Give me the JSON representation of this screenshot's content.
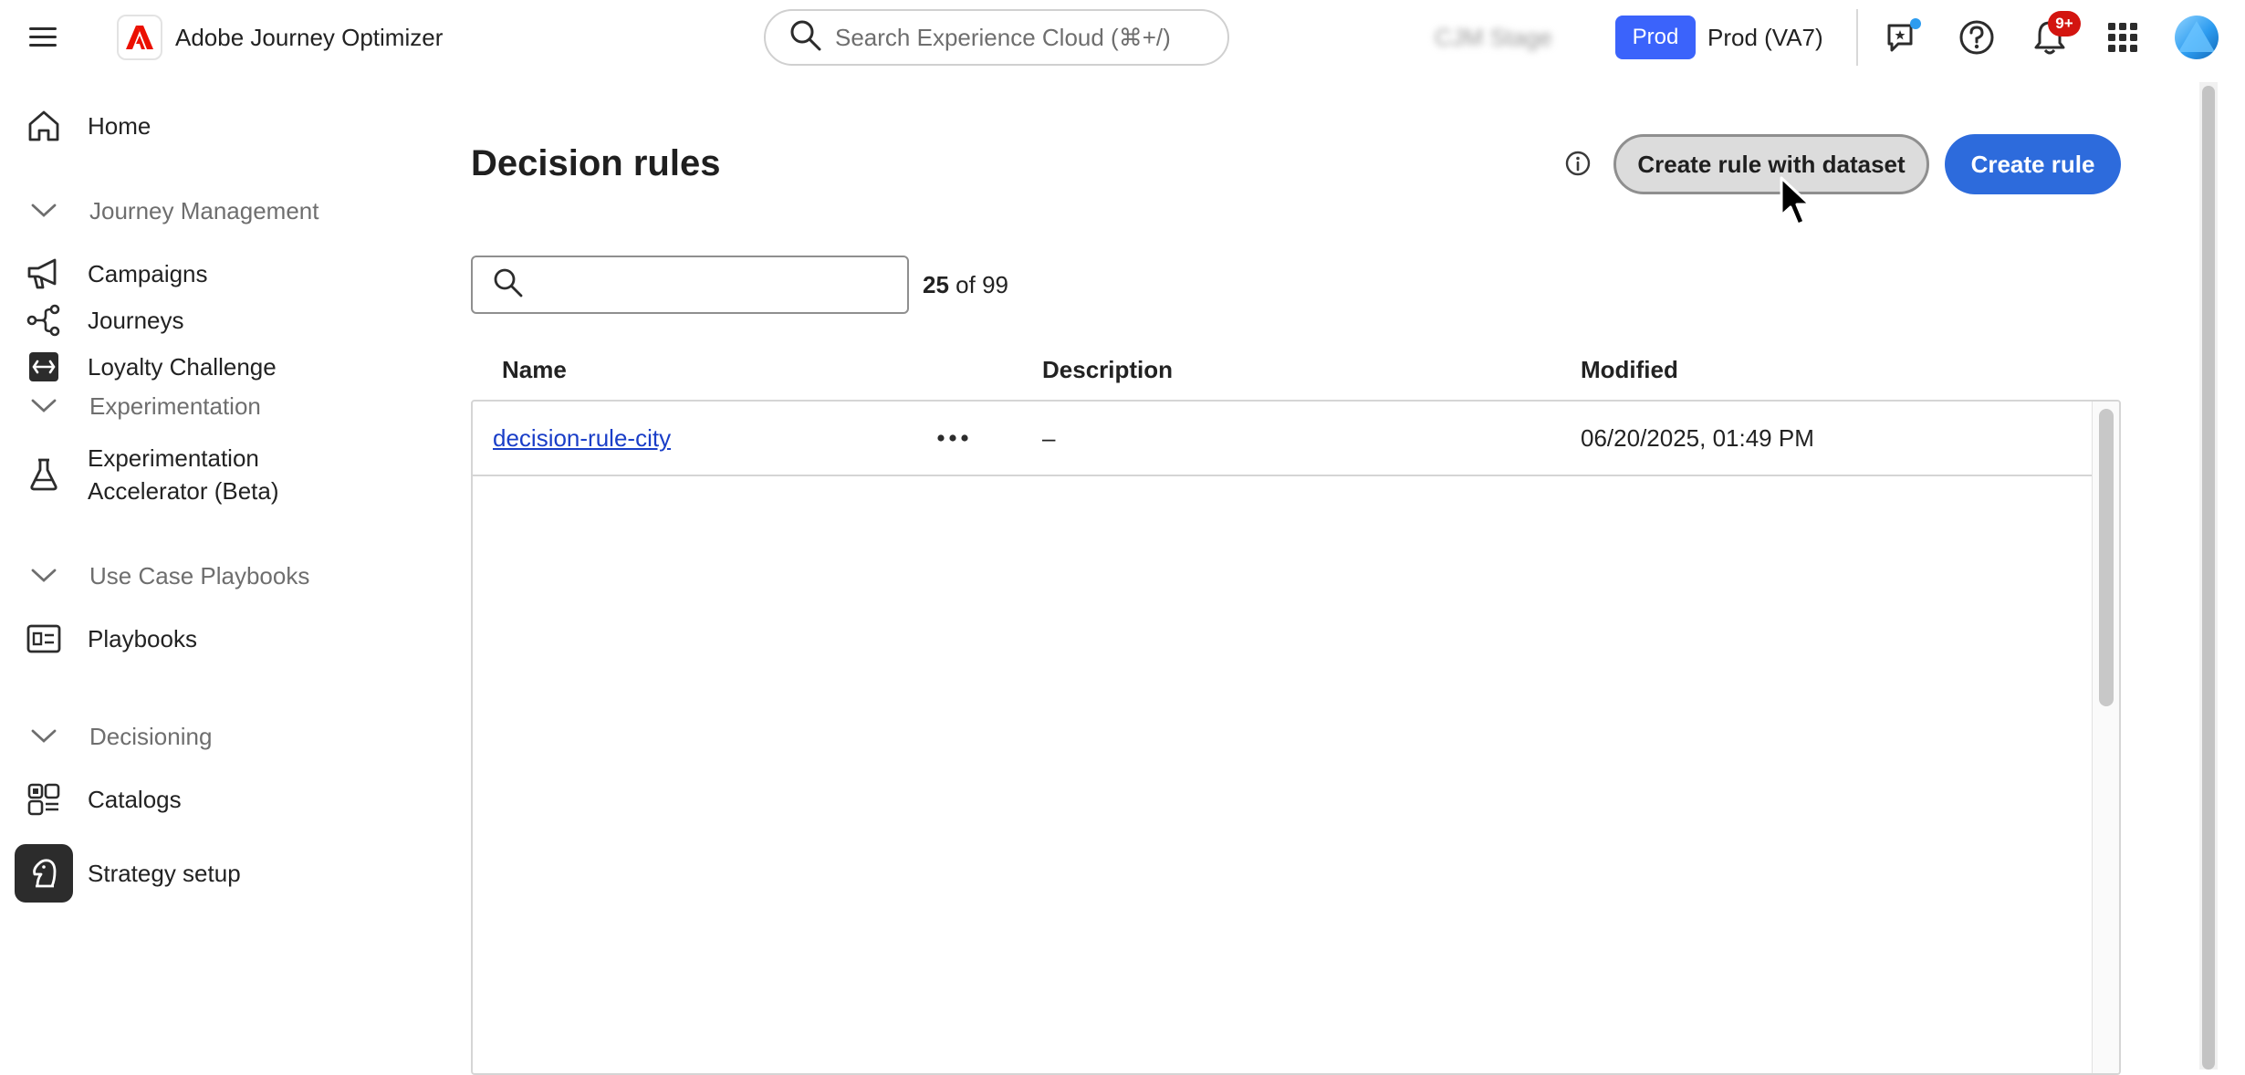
{
  "header": {
    "app_name": "Adobe Journey Optimizer",
    "search_placeholder": "Search Experience Cloud (⌘+/)",
    "stage_label": "CJM Stage",
    "env_badge": "Prod",
    "env_name": "Prod (VA7)",
    "notification_count": "9+"
  },
  "sidebar": {
    "home": "Home",
    "group_journey": "Journey Management",
    "campaigns": "Campaigns",
    "journeys": "Journeys",
    "loyalty": "Loyalty Challenge",
    "group_experimentation": "Experimentation",
    "exp_accel_line1": "Experimentation",
    "exp_accel_line2": "Accelerator (Beta)",
    "group_playbooks": "Use Case Playbooks",
    "playbooks": "Playbooks",
    "group_decisioning": "Decisioning",
    "catalogs": "Catalogs",
    "strategy": "Strategy setup"
  },
  "main": {
    "title": "Decision rules",
    "btn_dataset": "Create rule with dataset",
    "btn_create": "Create rule",
    "search_value": "",
    "count_shown": "25",
    "count_total": "of 99"
  },
  "table": {
    "columns": {
      "name": "Name",
      "description": "Description",
      "modified": "Modified"
    },
    "rows": [
      {
        "name": "decision-rule-city",
        "description": "–",
        "modified": "06/20/2025, 01:49 PM"
      }
    ]
  },
  "colors": {
    "accent": "#2d6bdc",
    "env_badge": "#3b63fb",
    "notification": "#d31510",
    "brand_red": "#eb1000"
  }
}
